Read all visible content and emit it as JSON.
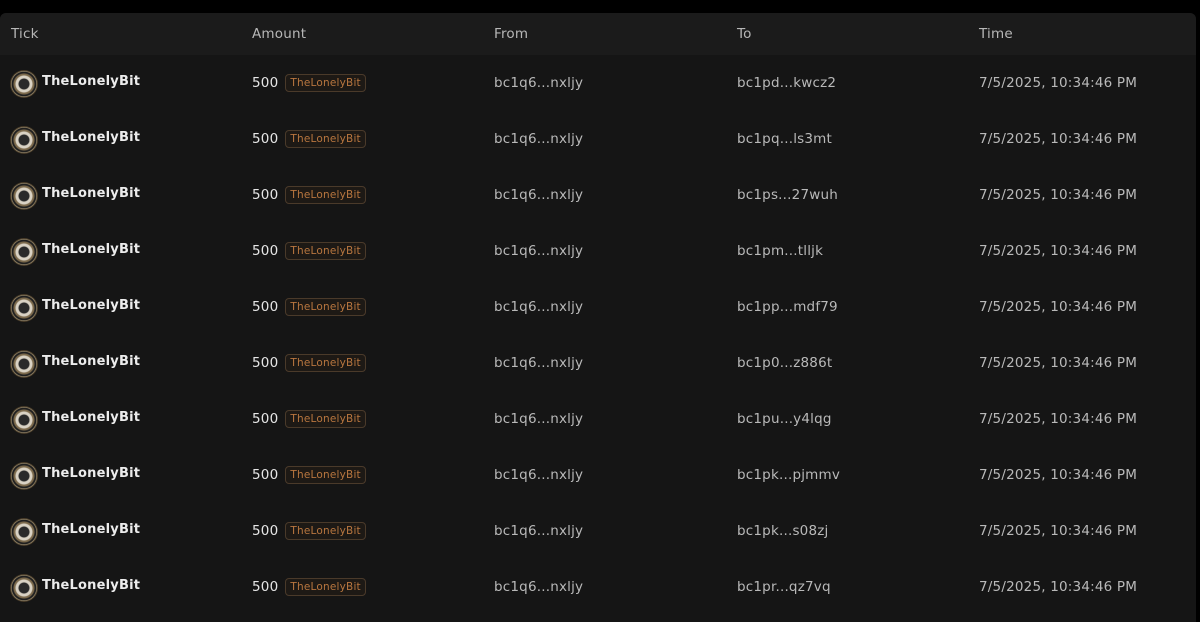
{
  "columns": {
    "tick": "Tick",
    "amount": "Amount",
    "from": "From",
    "to": "To",
    "time": "Time"
  },
  "colors": {
    "page_background": "#000000",
    "panel_background": "#151515",
    "header_background": "#1b1b1b",
    "badge_text": "#b8763f",
    "badge_border": "#4a3a2a"
  },
  "icons": {
    "tick_logo": "coin-logo-icon"
  },
  "rows": [
    {
      "tick": "TheLonelyBit",
      "amount": "500",
      "badge": "TheLonelyBit",
      "from": "bc1q6...nxljy",
      "to": "bc1pd...kwcz2",
      "time": "7/5/2025, 10:34:46 PM"
    },
    {
      "tick": "TheLonelyBit",
      "amount": "500",
      "badge": "TheLonelyBit",
      "from": "bc1q6...nxljy",
      "to": "bc1pq...ls3mt",
      "time": "7/5/2025, 10:34:46 PM"
    },
    {
      "tick": "TheLonelyBit",
      "amount": "500",
      "badge": "TheLonelyBit",
      "from": "bc1q6...nxljy",
      "to": "bc1ps...27wuh",
      "time": "7/5/2025, 10:34:46 PM"
    },
    {
      "tick": "TheLonelyBit",
      "amount": "500",
      "badge": "TheLonelyBit",
      "from": "bc1q6...nxljy",
      "to": "bc1pm...tlljk",
      "time": "7/5/2025, 10:34:46 PM"
    },
    {
      "tick": "TheLonelyBit",
      "amount": "500",
      "badge": "TheLonelyBit",
      "from": "bc1q6...nxljy",
      "to": "bc1pp...mdf79",
      "time": "7/5/2025, 10:34:46 PM"
    },
    {
      "tick": "TheLonelyBit",
      "amount": "500",
      "badge": "TheLonelyBit",
      "from": "bc1q6...nxljy",
      "to": "bc1p0...z886t",
      "time": "7/5/2025, 10:34:46 PM"
    },
    {
      "tick": "TheLonelyBit",
      "amount": "500",
      "badge": "TheLonelyBit",
      "from": "bc1q6...nxljy",
      "to": "bc1pu...y4lqg",
      "time": "7/5/2025, 10:34:46 PM"
    },
    {
      "tick": "TheLonelyBit",
      "amount": "500",
      "badge": "TheLonelyBit",
      "from": "bc1q6...nxljy",
      "to": "bc1pk...pjmmv",
      "time": "7/5/2025, 10:34:46 PM"
    },
    {
      "tick": "TheLonelyBit",
      "amount": "500",
      "badge": "TheLonelyBit",
      "from": "bc1q6...nxljy",
      "to": "bc1pk...s08zj",
      "time": "7/5/2025, 10:34:46 PM"
    },
    {
      "tick": "TheLonelyBit",
      "amount": "500",
      "badge": "TheLonelyBit",
      "from": "bc1q6...nxljy",
      "to": "bc1pr...qz7vq",
      "time": "7/5/2025, 10:34:46 PM"
    }
  ]
}
